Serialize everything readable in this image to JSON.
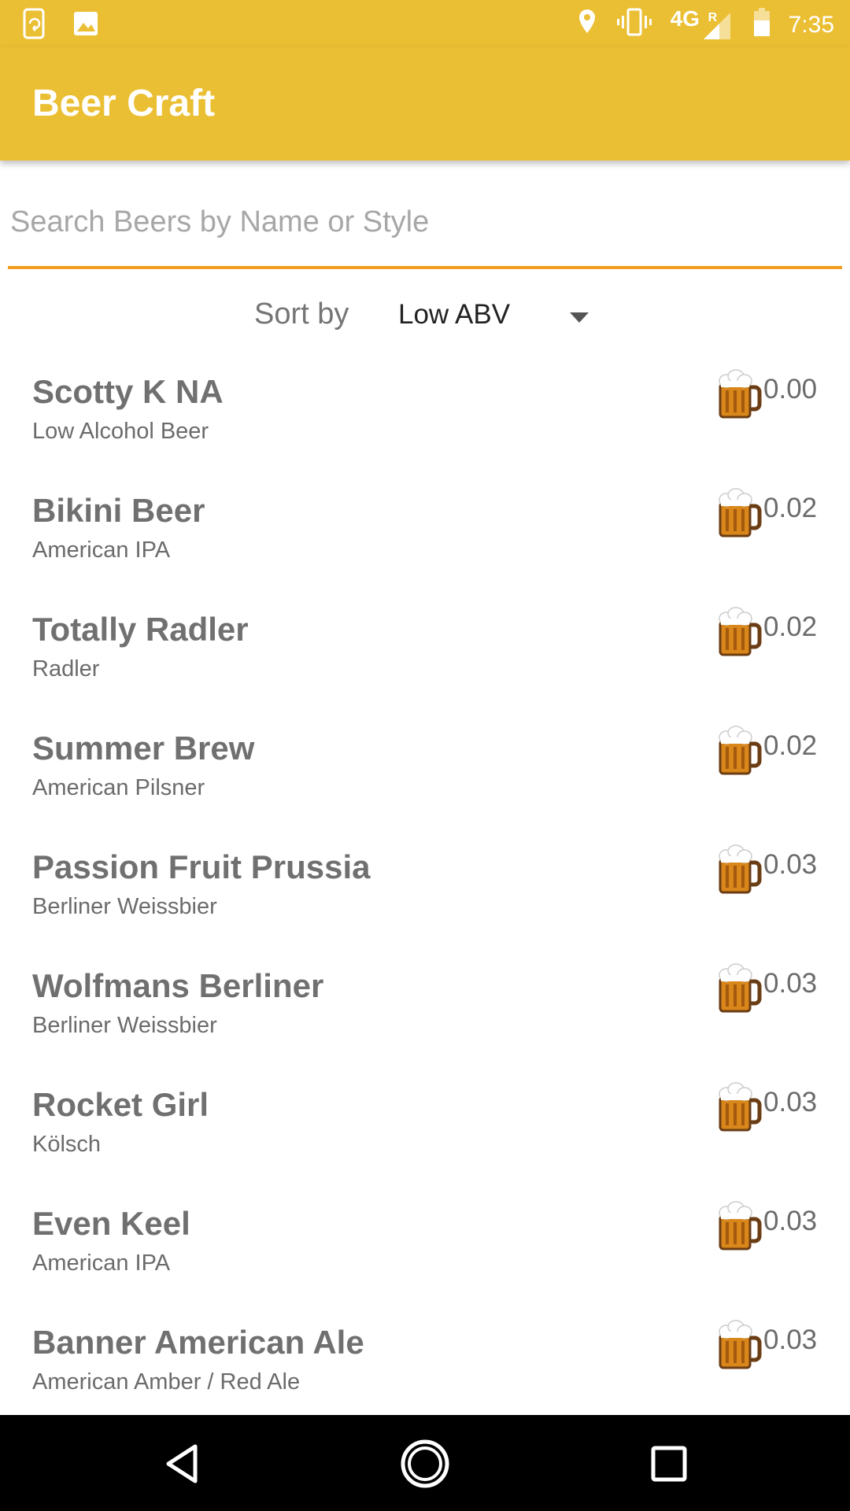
{
  "status_bar": {
    "network": "4G",
    "roaming": "R",
    "time": "7:35"
  },
  "app_bar": {
    "title": "Beer Craft"
  },
  "search": {
    "value": "",
    "placeholder": "Search Beers by Name or Style"
  },
  "sort": {
    "label": "Sort by",
    "selected": "Low ABV"
  },
  "beers": [
    {
      "name": "Scotty K NA",
      "style": "Low Alcohol Beer",
      "abv": "0.00"
    },
    {
      "name": "Bikini Beer",
      "style": "American IPA",
      "abv": "0.02"
    },
    {
      "name": "Totally Radler",
      "style": "Radler",
      "abv": "0.02"
    },
    {
      "name": "Summer Brew",
      "style": "American Pilsner",
      "abv": "0.02"
    },
    {
      "name": "Passion Fruit Prussia",
      "style": "Berliner Weissbier",
      "abv": "0.03"
    },
    {
      "name": "Wolfmans Berliner",
      "style": "Berliner Weissbier",
      "abv": "0.03"
    },
    {
      "name": "Rocket Girl",
      "style": "Kölsch",
      "abv": "0.03"
    },
    {
      "name": "Even Keel",
      "style": "American IPA",
      "abv": "0.03"
    },
    {
      "name": "Banner American Ale",
      "style": "American Amber / Red Ale",
      "abv": "0.03"
    }
  ],
  "icons": {
    "beer": "beer-mug-icon",
    "status_left": [
      "phone-sync-icon",
      "image-icon"
    ],
    "status_right": [
      "location-icon",
      "vibrate-icon",
      "signal-icon",
      "battery-icon"
    ],
    "nav": [
      "back-icon",
      "home-icon",
      "recents-icon"
    ]
  },
  "colors": {
    "primary": "#ebbf33",
    "accent": "#f39c1f",
    "beer_amber": "#d9861a"
  }
}
